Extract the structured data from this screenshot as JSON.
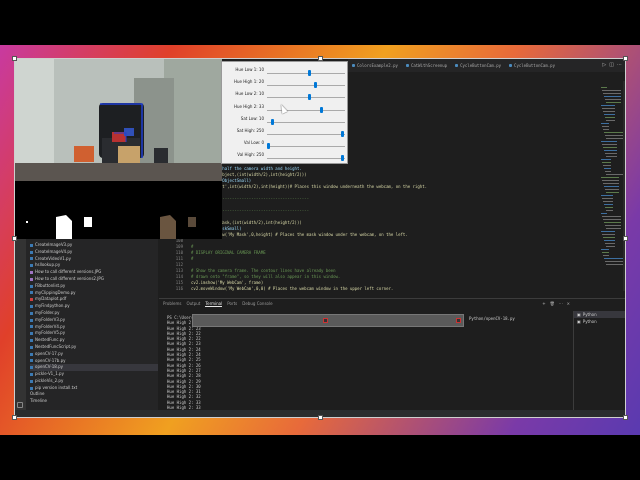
{
  "editor": {
    "tabs": [
      {
        "label": "ColorsExample2.py"
      },
      {
        "label": "CatWithScreenup"
      },
      {
        "label": "CycleButtonCam.py"
      },
      {
        "label": "CycleButtonCam.py"
      }
    ],
    "code_lines": [
      {
        "num": "",
        "text": "Object image half the camera width and height."
      },
      {
        "num": "",
        "text": "v2.resize(myObject,(int(width/2),int(height/2)))"
      },
      {
        "num": "",
        "text": "My Object',myObjectSmall)"
      },
      {
        "num": "",
        "text": "dow('My Object',int(width/2),int(height))# Places this window underneath the webcam, on the right."
      },
      {
        "num": "",
        "text": ""
      },
      {
        "num": "",
        "text": "#------------------------------------------------"
      },
      {
        "num": "",
        "text": "SE"
      },
      {
        "num": "",
        "text": "#------------------------------------------------"
      },
      {
        "num": "",
        "text": ""
      },
      {
        "num": "",
        "text": "v2.resize(myMask,(int(width/2),int(height/2)))"
      },
      {
        "num": "",
        "text": "y Mask', myMaskSmall)"
      },
      {
        "num": "107",
        "text": "cv2.moveWindow('My Mask',0,height) # Places the mask window under the webcam, on the left."
      },
      {
        "num": "108",
        "text": ""
      },
      {
        "num": "109",
        "text": "#"
      },
      {
        "num": "110",
        "text": "# DISPLAY ORIGINAL CAMERA FRAME"
      },
      {
        "num": "111",
        "text": "#"
      },
      {
        "num": "112",
        "text": ""
      },
      {
        "num": "113",
        "text": "# Show the camera frame. The contour lines have already been"
      },
      {
        "num": "114",
        "text": "# drawn onto \"frame\", so they will also appear in this window."
      },
      {
        "num": "115",
        "text": "cv2.imshow('My WebCam', frame)"
      },
      {
        "num": "116",
        "text": "cv2.moveWindow('My WebCam',0,0) # Places the webcam window in the upper left corner."
      }
    ]
  },
  "sidebar": {
    "files": [
      {
        "name": "CreateImageV3.py",
        "type": "py"
      },
      {
        "name": "CreateImageV4.py",
        "type": "py"
      },
      {
        "name": "CreateVideoV1.py",
        "type": "py"
      },
      {
        "name": "hsllookup.py",
        "type": "py"
      },
      {
        "name": "How to call different versions.JPG",
        "type": "img"
      },
      {
        "name": "How to call different versions2.JPG",
        "type": "img"
      },
      {
        "name": "FBbuttonlist.py",
        "type": "py"
      },
      {
        "name": "myClippingDemo.py",
        "type": "py"
      },
      {
        "name": "myDataplot.pdf",
        "type": "pdf"
      },
      {
        "name": "myFindpython.py",
        "type": "py"
      },
      {
        "name": "myFolder.py",
        "type": "py"
      },
      {
        "name": "myFolderV3.py",
        "type": "py"
      },
      {
        "name": "myFolderV4.py",
        "type": "py"
      },
      {
        "name": "myFolderV5.py",
        "type": "py"
      },
      {
        "name": "NestedFunc.py",
        "type": "py"
      },
      {
        "name": "NestedFuncScript.py",
        "type": "py"
      },
      {
        "name": "openCV-17.py",
        "type": "py"
      },
      {
        "name": "openCV-17b.py",
        "type": "py"
      },
      {
        "name": "openCV-18.py",
        "type": "py",
        "selected": true
      },
      {
        "name": "pickle-V1_1.py",
        "type": "py"
      },
      {
        "name": "pickleVis_2.py",
        "type": "py"
      },
      {
        "name": "pip version install.txt",
        "type": "py"
      }
    ],
    "outline": [
      "Outline",
      "Timeline"
    ]
  },
  "panel": {
    "tabs": [
      "Problems",
      "Output",
      "Terminal",
      "Ports",
      "Debug Console"
    ],
    "active_tab": "Terminal",
    "terminal_lines": [
      "PS C:\\Users\\",
      "Hue High 2: 24",
      "Hue High 2: 23",
      "Hue High 2: 22",
      "Hue High 2: 22",
      "Hue High 2: 23",
      "Hue High 2: 24",
      "Hue High 2: 24",
      "Hue High 2: 25",
      "Hue High 2: 26",
      "Hue High 2: 27",
      "Hue High 2: 28",
      "Hue High 2: 29",
      "Hue High 2: 30",
      "Hue High 2: 31",
      "Hue High 2: 32",
      "Hue High 2: 33",
      "Hue High 2: 33"
    ],
    "terminal_path_suffix": "Python/openCV-18.py",
    "terminal_sessions": [
      "Python",
      "Python"
    ]
  },
  "trackbars": [
    {
      "label": "Hue Low 1: 10",
      "value": 0.55
    },
    {
      "label": "Hue High 1: 20",
      "value": 0.62
    },
    {
      "label": "Hue Low 2: 10",
      "value": 0.55
    },
    {
      "label": "Hue High 2: 33",
      "value": 0.7
    },
    {
      "label": "Sat Low: 10",
      "value": 0.05
    },
    {
      "label": "Sat High: 250",
      "value": 0.98
    },
    {
      "label": "Val Low: 0",
      "value": 0.0
    },
    {
      "label": "Val High: 250",
      "value": 0.98
    }
  ],
  "colors": {
    "editor_bg": "#1e1e1e",
    "sidebar_bg": "#252526",
    "accent": "#0078d7"
  }
}
